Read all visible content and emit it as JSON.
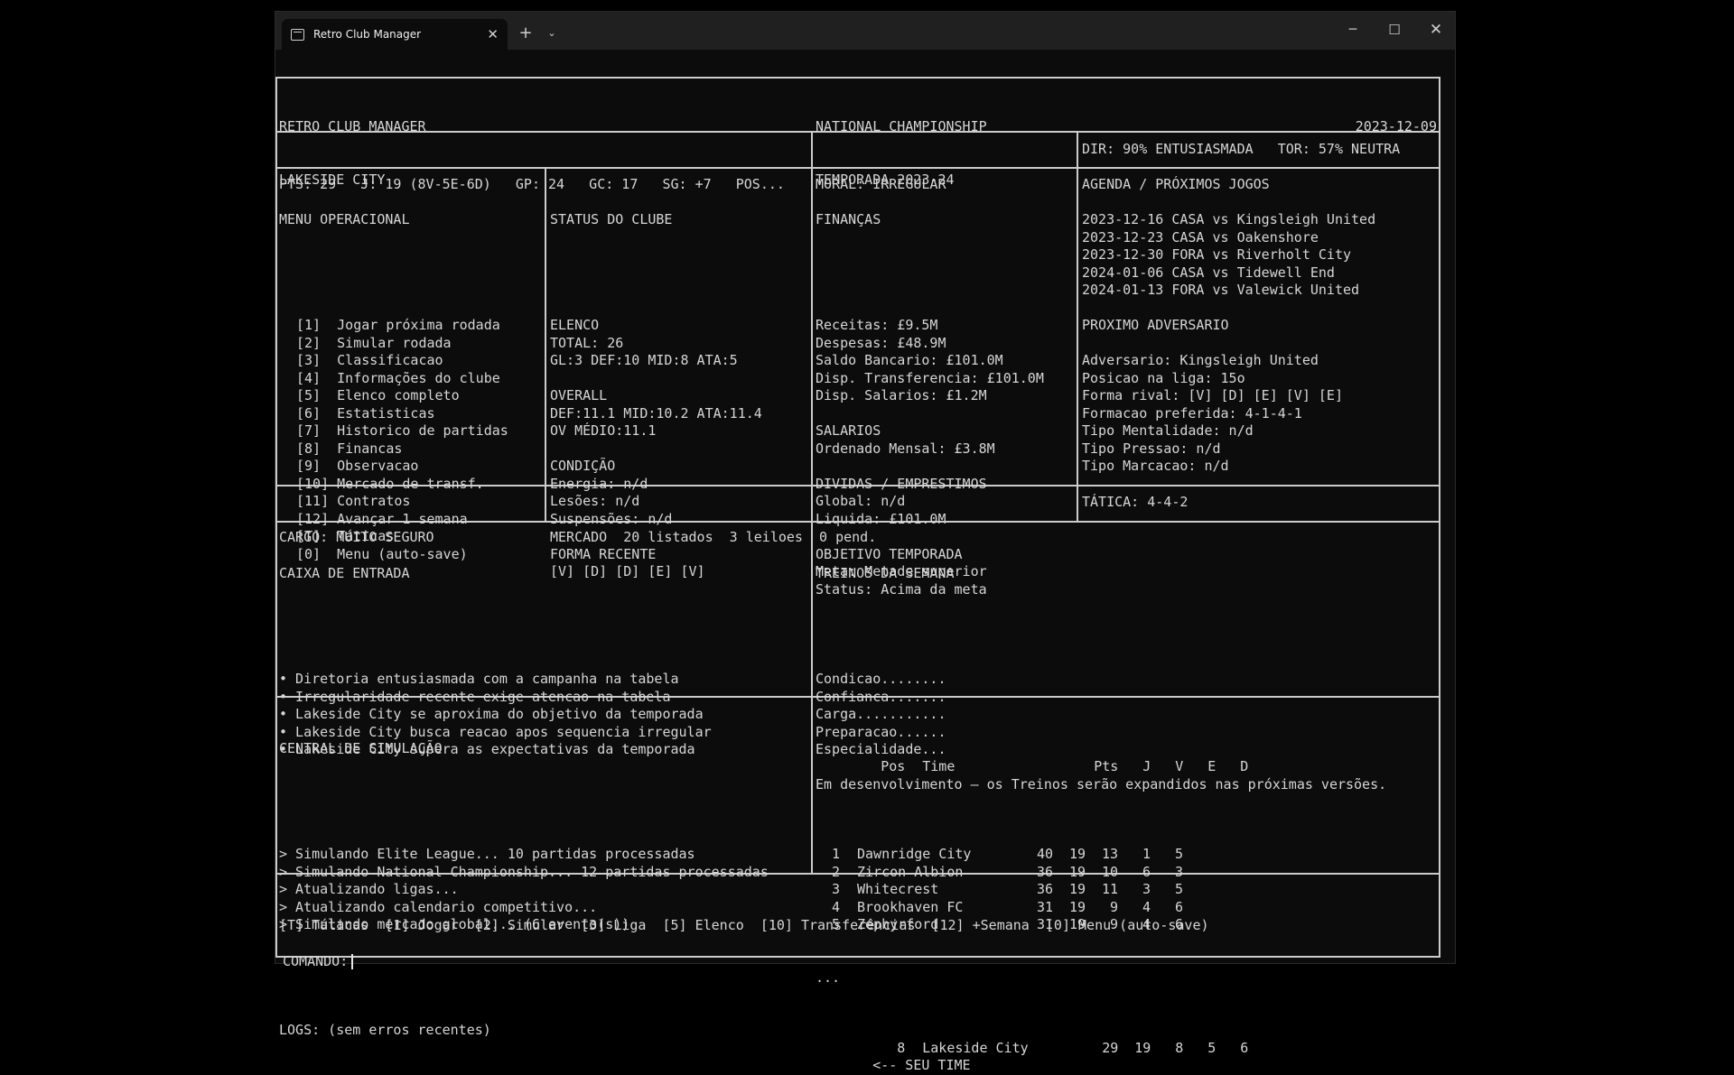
{
  "window": {
    "tab_title": "Retro Club Manager",
    "icons": {
      "tab": "terminal-icon",
      "close": "close-icon",
      "new": "plus-icon",
      "dropdown": "chevron-down-icon"
    }
  },
  "header": {
    "app_name": "RETRO CLUB MANAGER",
    "club": "LAKESIDE CITY",
    "competition": "NATIONAL CHAMPIONSHIP",
    "season": "TEMPORADA 2023-24",
    "date": "2023-12-09"
  },
  "stats": {
    "summary": "PTS: 29   J: 19 (8V-5E-6D)   GP: 24   GC: 17   SG: +7   POS...",
    "moral": "MORAL: IRREGULAR",
    "board": "DIR: 90% ENTUSIASMADA   TOR: 57% NEUTRA"
  },
  "menu": {
    "title": "MENU OPERACIONAL",
    "items": [
      "[1]  Jogar próxima rodada",
      "[2]  Simular rodada",
      "[3]  Classificacao",
      "[4]  Informações do clube",
      "[5]  Elenco completo",
      "[6]  Estatisticas",
      "[7]  Historico de partidas",
      "[8]  Financas",
      "[9]  Observacao",
      "[10] Mercado de transf.",
      "[11] Contratos",
      "[12] Avançar 1 semana",
      "[T]  Táticas",
      "[0]  Menu (auto-save)"
    ]
  },
  "club_status": {
    "title": "STATUS DO CLUBE",
    "lines": [
      "ELENCO",
      "TOTAL: 26",
      "GL:3 DEF:10 MID:8 ATA:5",
      "",
      "OVERALL",
      "DEF:11.1 MID:10.2 ATA:11.4",
      "OV MÉDIO:11.1",
      "",
      "CONDIÇÃO",
      "Energia: n/d",
      "Lesões: n/d",
      "Suspensões: n/d",
      "",
      "FORMA RECENTE",
      "[V] [D] [D] [E] [V]"
    ]
  },
  "finances": {
    "title": "FINANÇAS",
    "lines": [
      "Receitas: £9.5M",
      "Despesas: £48.9M",
      "Saldo Bancario: £101.0M",
      "Disp. Transferencia: £101.0M",
      "Disp. Salarios: £1.2M",
      "",
      "SALARIOS",
      "Ordenado Mensal: £3.8M",
      "",
      "DIVIDAS / EMPRESTIMOS",
      "Global: n/d",
      "Liquida: £101.0M",
      "",
      "OBJETIVO TEMPORADA",
      "Meta: Metade superior",
      "Status: Acima da meta"
    ]
  },
  "schedule": {
    "title": "AGENDA / PRÓXIMOS JOGOS",
    "lines": [
      "2023-12-16 CASA vs Kingsleigh United",
      "2023-12-23 CASA vs Oakenshore",
      "2023-12-30 FORA vs Riverholt City",
      "2024-01-06 CASA vs Tidewell End",
      "2024-01-13 FORA vs Valewick United",
      "",
      "PROXIMO ADVERSARIO",
      "",
      "Adversario: Kingsleigh United",
      "Posicao na liga: 15o",
      "Forma rival: [V] [D] [E] [V] [E]",
      "Formacao preferida: 4-1-4-1",
      "Tipo Mentalidade: n/d",
      "Tipo Pressao: n/d",
      "Tipo Marcacao: n/d"
    ]
  },
  "status_bar": {
    "job": "CARGO: MUITO SEGURO",
    "market": "MERCADO  20 listados  3 leiloes  0 pend.",
    "tactic": "TÁTICA: 4-4-2"
  },
  "inbox": {
    "title": "CAIXA DE ENTRADA",
    "items": [
      "• Diretoria entusiasmada com a campanha na tabela",
      "• Irregularidade recente exige atencao na tabela",
      "• Lakeside City se aproxima do objetivo da temporada",
      "• Lakeside City busca reacao apos sequencia irregular",
      "• Lakeside City supera as expectativas da temporada"
    ]
  },
  "training": {
    "title": "TREINOS DA SEMANA",
    "items": [
      "Condicao........",
      "Confianca.......",
      "Carga...........",
      "Preparacao......",
      "Especialidade..."
    ],
    "note": "Em desenvolvimento — os Treinos serão expandidos nas próximas versões."
  },
  "simulation": {
    "title": "CENTRAL DE SIMULAÇÃO",
    "lines": [
      "> Simulando Elite League... 10 partidas processadas",
      "> Simulando National Championship... 12 partidas processadas",
      "> Atualizando ligas...",
      "> Atualizando calendario competitivo...",
      "> Simulando mercado global... (6 evento(s))"
    ],
    "logs": "LOGS: (sem erros recentes)"
  },
  "table": {
    "headers": {
      "pos": "Pos",
      "team": "Time",
      "pts": "Pts",
      "j": "J",
      "v": "V",
      "e": "E",
      "d": "D"
    },
    "rows": [
      {
        "pos": "1",
        "team": "Dawnridge City",
        "pts": "40",
        "j": "19",
        "v": "13",
        "e": "1",
        "d": "5",
        "note": ""
      },
      {
        "pos": "2",
        "team": "Zircon Albion",
        "pts": "36",
        "j": "19",
        "v": "10",
        "e": "6",
        "d": "3",
        "note": ""
      },
      {
        "pos": "3",
        "team": "Whitecrest",
        "pts": "36",
        "j": "19",
        "v": "11",
        "e": "3",
        "d": "5",
        "note": ""
      },
      {
        "pos": "4",
        "team": "Brookhaven FC",
        "pts": "31",
        "j": "19",
        "v": "9",
        "e": "4",
        "d": "6",
        "note": ""
      },
      {
        "pos": "5",
        "team": "Zephyrford",
        "pts": "31",
        "j": "19",
        "v": "9",
        "e": "4",
        "d": "6",
        "note": ""
      }
    ],
    "ellipsis": "...",
    "own_row": {
      "pos": "8",
      "team": "Lakeside City",
      "pts": "29",
      "j": "19",
      "v": "8",
      "e": "5",
      "d": "6",
      "note": "<-- SEU TIME"
    }
  },
  "shortcuts": "[T] Táticas  [1] Jogar  [2] Simular  [3] Liga  [5] Elenco  [10] Transferências  [12] +Semana  [0] Menu (auto-save)",
  "prompt": {
    "label": "COMANDO:",
    "value": ""
  }
}
